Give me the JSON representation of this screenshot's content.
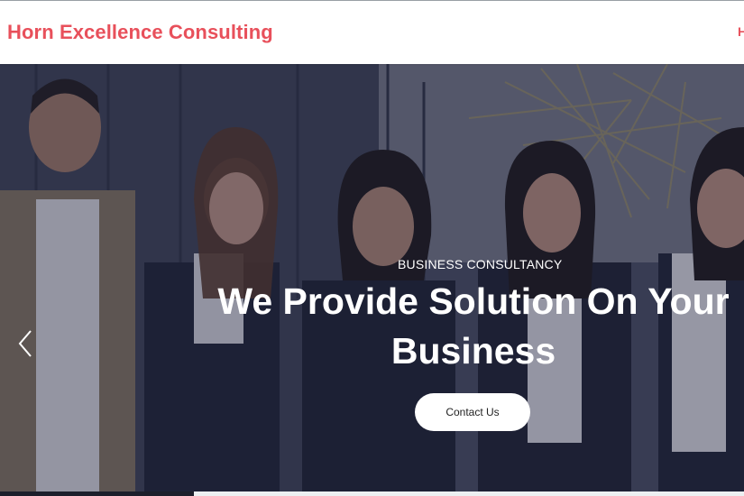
{
  "header": {
    "brand": "Horn Excellence Consulting",
    "nav_partial": "H"
  },
  "hero": {
    "eyebrow": "BUSINESS CONSULTANCY",
    "headline": "We Provide Solution On Your Business",
    "cta_label": "Contact Us",
    "prev_icon": "chevron-left-icon",
    "image_alt": "team of five business professionals"
  },
  "colors": {
    "brand": "#e8505b",
    "overlay": "#1e223c",
    "cta_bg": "#ffffff"
  }
}
